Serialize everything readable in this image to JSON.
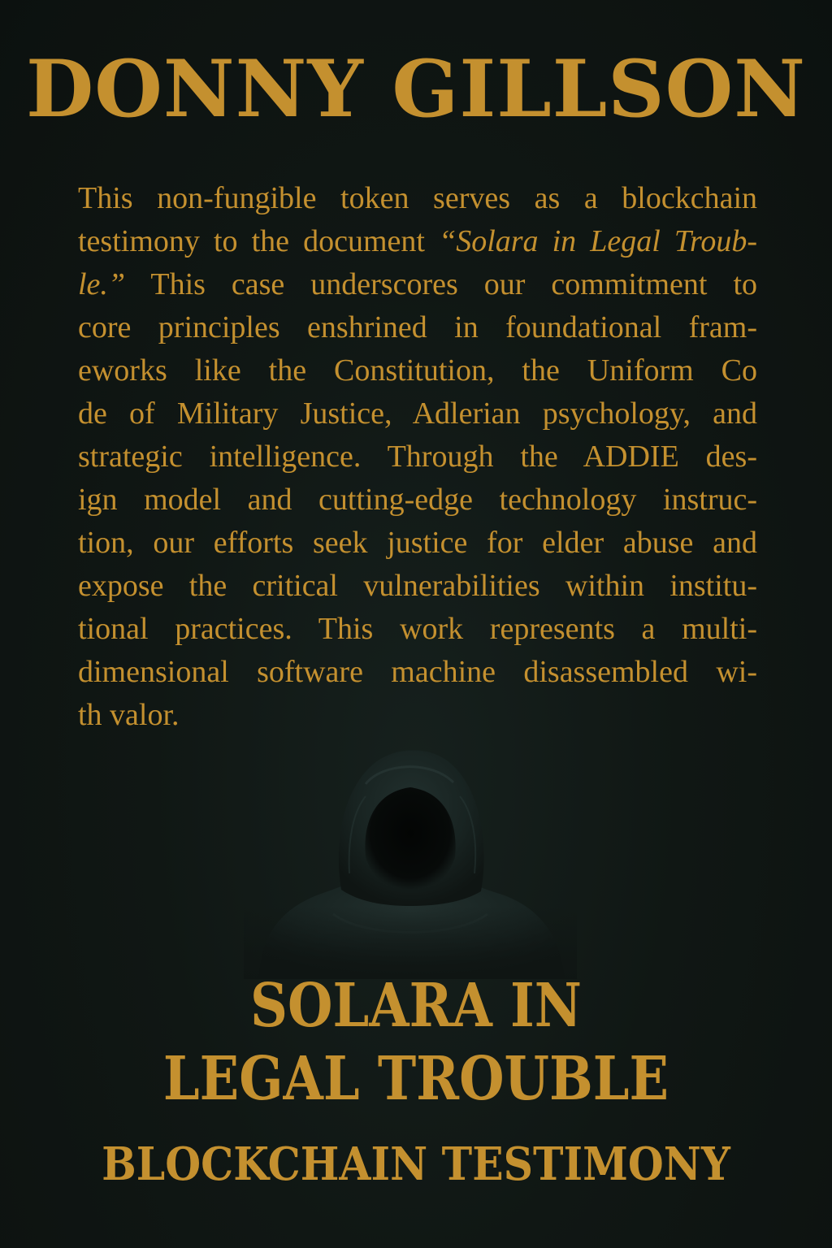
{
  "author": "DONNY GILLSON",
  "body_lines": [
    {
      "pre": "This non-fungible token serves as a blockchain",
      "ital": "",
      "post": ""
    },
    {
      "pre": "testimony to the document ",
      "ital": "“Solara in Legal Troub-",
      "post": ""
    },
    {
      "pre": "",
      "ital": "le.”",
      "post": " This case underscores our commitment to"
    },
    {
      "pre": "core principles enshrined in foundational fram-",
      "ital": "",
      "post": ""
    },
    {
      "pre": "eworks like the Constitution, the Uniform Co",
      "ital": "",
      "post": ""
    },
    {
      "pre": "de of Military Justice, Adlerian psychology, and",
      "ital": "",
      "post": ""
    },
    {
      "pre": "strategic intelligence. Through the ADDIE des-",
      "ital": "",
      "post": ""
    },
    {
      "pre": "ign model and cutting-edge technology instruc-",
      "ital": "",
      "post": ""
    },
    {
      "pre": "tion, our efforts seek justice for elder abuse and",
      "ital": "",
      "post": ""
    },
    {
      "pre": "expose the critical vulnerabilities within institu-",
      "ital": "",
      "post": ""
    },
    {
      "pre": "tional practices. This work represents a multi-",
      "ital": "",
      "post": ""
    },
    {
      "pre": "dimensional software machine disassembled wi-",
      "ital": "",
      "post": ""
    },
    {
      "pre": "th valor.",
      "ital": "",
      "post": ""
    }
  ],
  "title_line_1": "SOLARA IN",
  "title_line_2": "LEGAL TROUBLE",
  "subtitle": "BLOCKCHAIN TESTIMONY",
  "colors": {
    "background": "#0f1513",
    "text_gold": "#c4902f",
    "hood_fabric": "#1b2826"
  },
  "icons": {
    "figure": "hooded-figure-icon"
  }
}
